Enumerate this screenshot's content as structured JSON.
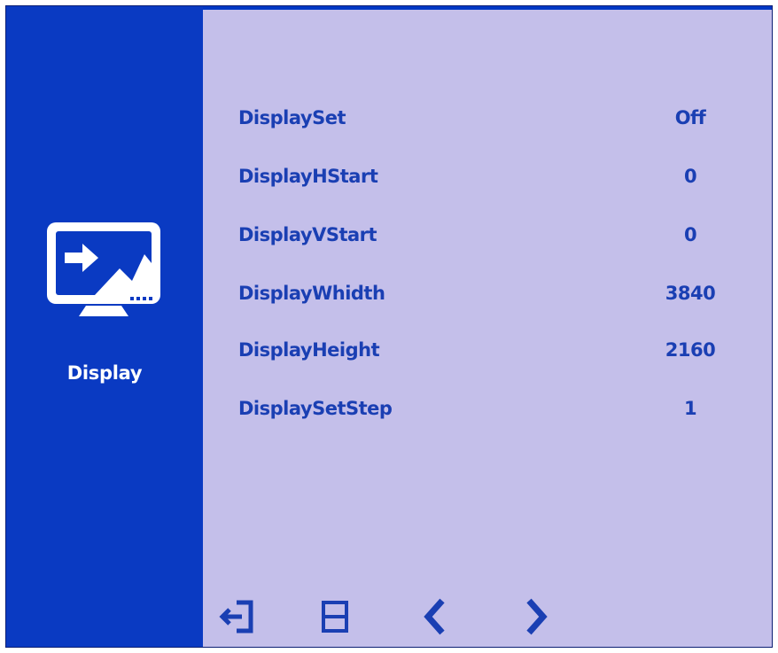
{
  "sidebar": {
    "label": "Display",
    "icon": "display-monitor-icon"
  },
  "menu": {
    "items": [
      {
        "label": "DisplaySet",
        "value": "Off"
      },
      {
        "label": "DisplayHStart",
        "value": "0"
      },
      {
        "label": "DisplayVStart",
        "value": "0"
      },
      {
        "label": "DisplayWhidth",
        "value": "3840"
      },
      {
        "label": "DisplayHeight",
        "value": "2160"
      },
      {
        "label": "DisplaySetStep",
        "value": "1"
      }
    ]
  },
  "controls": {
    "buttons": [
      "exit-icon",
      "menu-select-icon",
      "chevron-left-icon",
      "chevron-right-icon"
    ]
  },
  "colors": {
    "sidebar_bg": "#0a3ac2",
    "panel_bg": "#c4bfea",
    "text": "#1a3fb3",
    "white": "#ffffff"
  }
}
